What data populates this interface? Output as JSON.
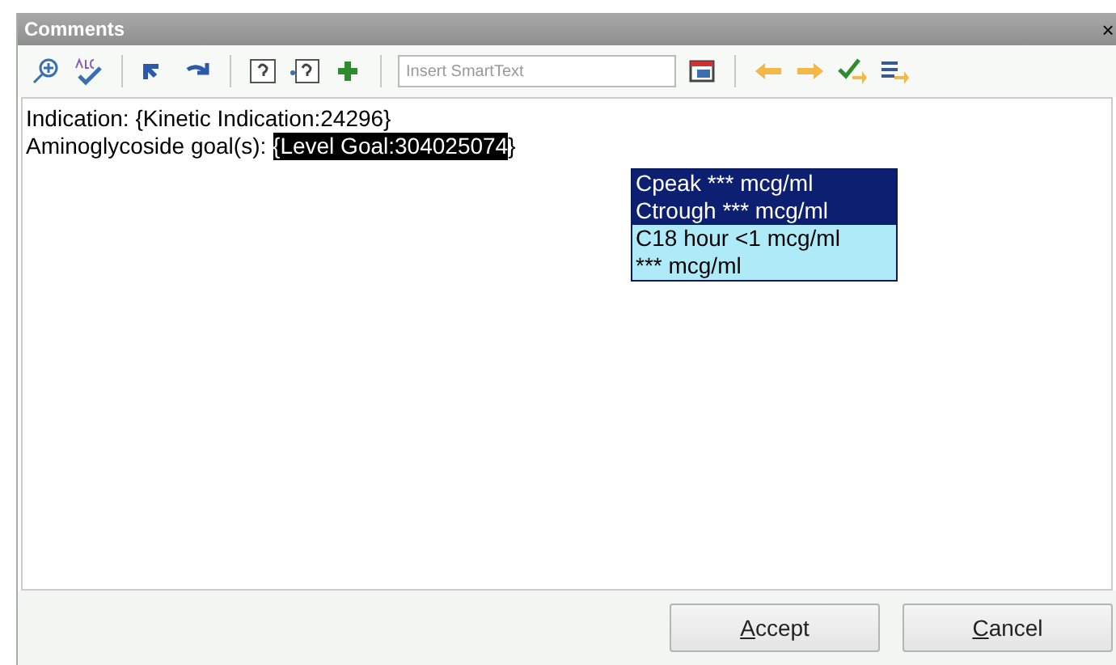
{
  "window": {
    "title": "Comments",
    "close": "×"
  },
  "toolbar": {
    "smarttext": {
      "placeholder": "Insert SmartText"
    }
  },
  "lines": [
    [
      {
        "text": "Indication: {Kinetic Indication:24296}",
        "selected": false
      }
    ],
    [
      {
        "text": "Aminoglycoside goal(s): ",
        "selected": false
      },
      {
        "text": "{Level Goal:304025074",
        "selected": true
      },
      {
        "text": "}",
        "selected": false
      }
    ]
  ],
  "dropdown": [
    {
      "label": "Cpeak *** mcg/ml",
      "selected": true
    },
    {
      "label": "Ctrough *** mcg/ml",
      "selected": true
    },
    {
      "label": "C18 hour <1 mcg/ml",
      "selected": false
    },
    {
      "label": "*** mcg/ml",
      "selected": false
    }
  ],
  "buttons": [
    {
      "label": "Accept",
      "mnemonic": true
    },
    {
      "label": "Cancel",
      "mnemonic": true
    }
  ]
}
